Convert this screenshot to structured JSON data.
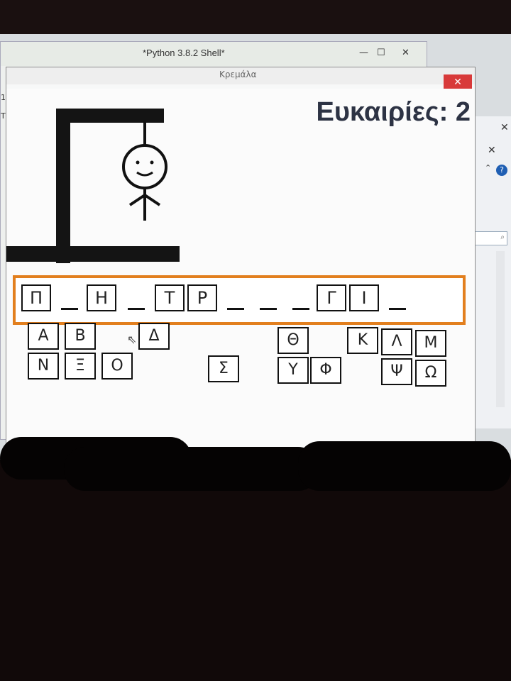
{
  "shell_window": {
    "title": "*Python 3.8.2 Shell*",
    "close_label": "✕"
  },
  "game_window": {
    "title": "Κρεμάλα",
    "close_label": "✕"
  },
  "status": {
    "chances_label": "Ευκαιρίες: 2",
    "chances_remaining": 2
  },
  "word_slots": [
    "Π",
    "_",
    "Η",
    "_",
    "Τ",
    "Ρ",
    "_",
    "_",
    "_",
    "Γ",
    "Ι",
    "_"
  ],
  "keyboard": {
    "row1": [
      "Α",
      "Β",
      "Δ",
      "Θ",
      "Κ",
      "Λ",
      "Μ"
    ],
    "row2": [
      "Ν",
      "Ξ",
      "Ο",
      "Σ",
      "Υ",
      "Φ",
      "Ψ",
      "Ω"
    ]
  },
  "icons": {
    "help": "question-mark",
    "close": "x-mark",
    "search": "magnifier",
    "cursor": "mouse-pointer"
  },
  "colors": {
    "word_frame": "#e27f1e",
    "close_button": "#d83a3a",
    "title_text": "#2d3344"
  }
}
